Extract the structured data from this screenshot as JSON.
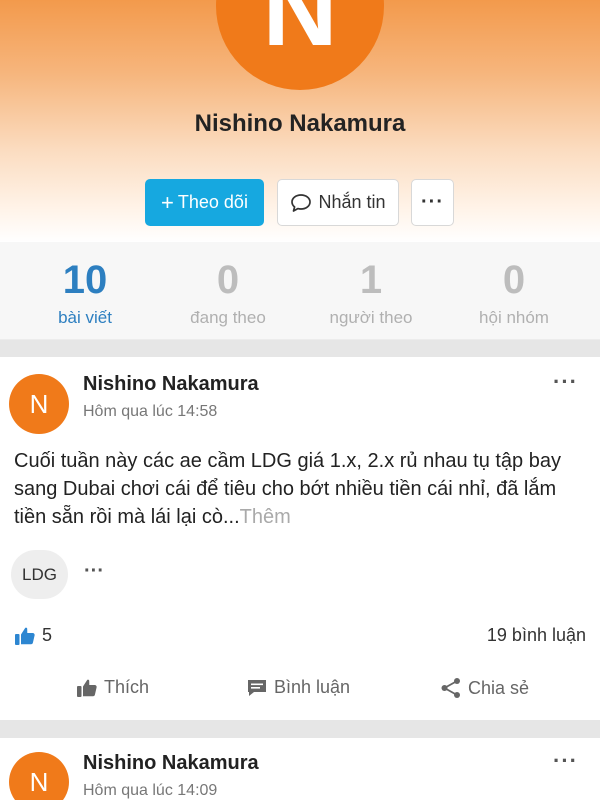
{
  "profile": {
    "avatar_letter": "N",
    "name": "Nishino Nakamura",
    "follow_label": "Theo dõi",
    "message_label": "Nhắn tin",
    "more_label": "···"
  },
  "stats": [
    {
      "value": "10",
      "label": "bài viết"
    },
    {
      "value": "0",
      "label": "đang theo"
    },
    {
      "value": "1",
      "label": "người theo"
    },
    {
      "value": "0",
      "label": "hội nhóm"
    }
  ],
  "posts": [
    {
      "avatar_letter": "N",
      "author": "Nishino Nakamura",
      "time": "Hôm qua lúc 14:58",
      "menu": "···",
      "content": "Cuối tuần này các ae cầm LDG giá 1.x, 2.x rủ nhau tụ tập bay sang Dubai chơi cái để tiêu cho bớt nhiều tiền cái nhỉ, đã lắm tiền sẵn rồi mà lái lại cò...",
      "see_more": "Thêm",
      "tag": "LDG",
      "tag_more": "···",
      "likes": "5",
      "comments": "19 bình luận",
      "actions": {
        "like": "Thích",
        "comment": "Bình luận",
        "share": "Chia sẻ"
      }
    },
    {
      "avatar_letter": "N",
      "author": "Nishino Nakamura",
      "time": "Hôm qua lúc 14:09",
      "menu": "···"
    }
  ],
  "colors": {
    "accent": "#16a8e0",
    "avatar": "#f07a1a",
    "stat_active": "#2d7fc0",
    "like_icon": "#2d86d1"
  }
}
